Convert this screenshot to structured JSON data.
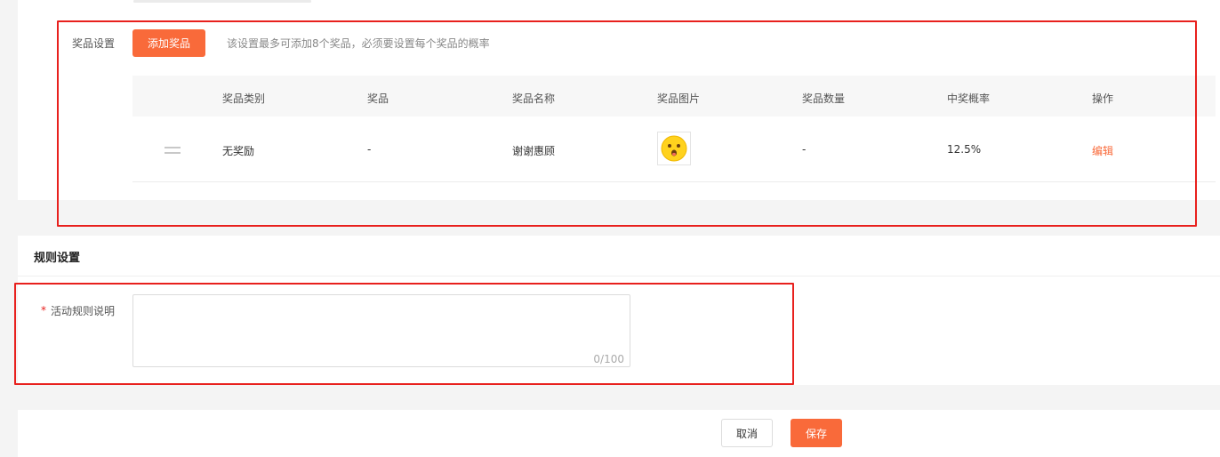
{
  "prize_section": {
    "label": "奖品设置",
    "add_button": "添加奖品",
    "hint": "该设置最多可添加8个奖品，必须要设置每个奖品的概率",
    "table": {
      "headers": [
        "奖品类别",
        "奖品",
        "奖品名称",
        "奖品图片",
        "奖品数量",
        "中奖概率",
        "操作"
      ],
      "rows": [
        {
          "category": "无奖励",
          "prize": "-",
          "name": "谢谢惠顾",
          "image_icon": "smiley-face-icon",
          "quantity": "-",
          "probability": "12.5%",
          "action": "编辑"
        }
      ]
    }
  },
  "rules_section": {
    "title": "规则设置",
    "required_mark": "*",
    "field_label": "活动规则说明",
    "textarea_value": "",
    "counter": "0/100"
  },
  "footer": {
    "cancel": "取消",
    "save": "保存"
  },
  "colors": {
    "accent": "#f96a3a",
    "highlight_box": "#e8201d",
    "link": "#f96a3a"
  }
}
